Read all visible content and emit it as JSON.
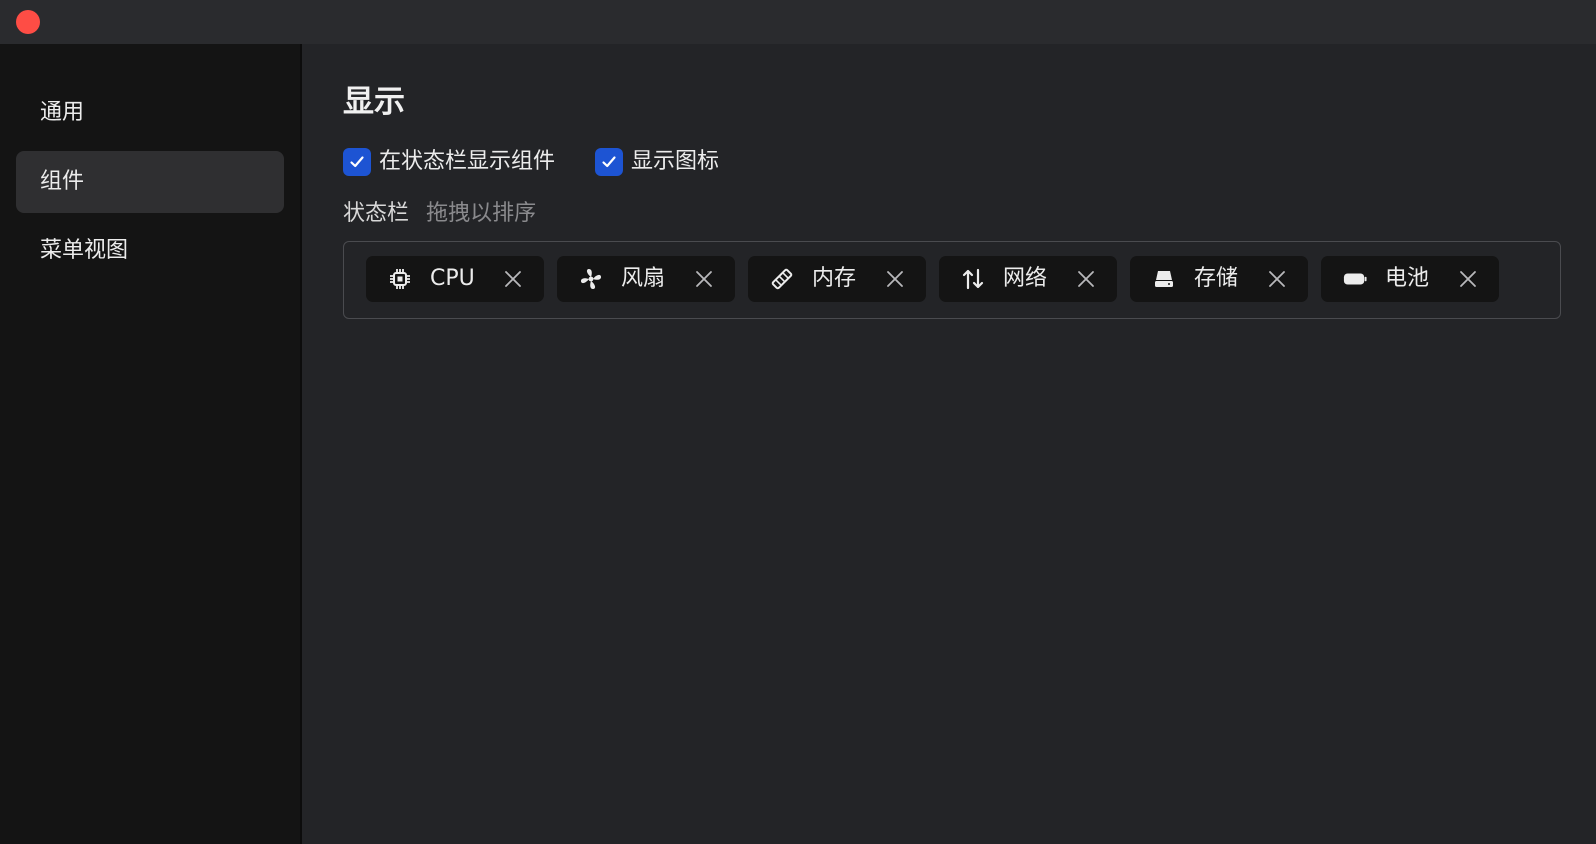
{
  "window": {
    "close_color": "#fe4d45"
  },
  "sidebar": {
    "items": [
      {
        "label": "通用",
        "active": false
      },
      {
        "label": "组件",
        "active": true
      },
      {
        "label": "菜单视图",
        "active": false
      }
    ]
  },
  "main": {
    "section_title": "显示",
    "options": [
      {
        "label": "在状态栏显示组件",
        "checked": true
      },
      {
        "label": "显示图标",
        "checked": true
      }
    ],
    "status_bar": {
      "title": "状态栏",
      "hint": "拖拽以排序",
      "widgets": [
        {
          "label": "CPU",
          "icon": "cpu-icon"
        },
        {
          "label": "风扇",
          "icon": "fan-icon"
        },
        {
          "label": "内存",
          "icon": "memory-icon"
        },
        {
          "label": "网络",
          "icon": "network-arrows-icon"
        },
        {
          "label": "存储",
          "icon": "storage-drive-icon"
        },
        {
          "label": "电池",
          "icon": "battery-icon"
        }
      ]
    }
  },
  "colors": {
    "accent": "#1d54d3",
    "sidebar_bg": "#141414",
    "content_bg": "#232427",
    "chip_bg": "#141414"
  }
}
